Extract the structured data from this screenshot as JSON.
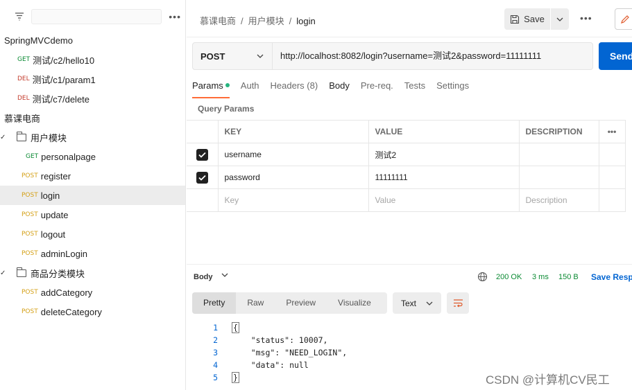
{
  "sidebar": {
    "more": "•••",
    "items": [
      {
        "kind": "collection",
        "label": "SpringMVCdemo"
      },
      {
        "kind": "request",
        "method": "GET",
        "label": "测试/c2/hello10"
      },
      {
        "kind": "request",
        "method": "DEL",
        "label": "测试/c1/param1"
      },
      {
        "kind": "request",
        "method": "DEL",
        "label": "测试/c7/delete"
      },
      {
        "kind": "collection",
        "label": "慕课电商"
      },
      {
        "kind": "folder",
        "label": "用户模块"
      },
      {
        "kind": "request",
        "method": "GET",
        "label": "personalpage"
      },
      {
        "kind": "request",
        "method": "POST",
        "label": "register"
      },
      {
        "kind": "request",
        "method": "POST",
        "label": "login"
      },
      {
        "kind": "request",
        "method": "POST",
        "label": "update"
      },
      {
        "kind": "request",
        "method": "POST",
        "label": "logout"
      },
      {
        "kind": "request",
        "method": "POST",
        "label": "adminLogin"
      },
      {
        "kind": "folder",
        "label": "商品分类模块"
      },
      {
        "kind": "request",
        "method": "POST",
        "label": "addCategory"
      },
      {
        "kind": "request",
        "method": "POST",
        "label": "deleteCategory"
      }
    ]
  },
  "breadcrumb": {
    "collection": "慕课电商",
    "folder": "用户模块",
    "current": "login",
    "sep": "/"
  },
  "toolbar": {
    "save_label": "Save",
    "more": "•••"
  },
  "request": {
    "method": "POST",
    "url": "http://localhost:8082/login?username=测试2&password=11111111",
    "send_label": "Send"
  },
  "tabs": {
    "params": "Params",
    "auth": "Auth",
    "headers": "Headers (8)",
    "body": "Body",
    "prereq": "Pre-req.",
    "tests": "Tests",
    "settings": "Settings"
  },
  "params": {
    "section_label": "Query Params",
    "headers": {
      "key": "KEY",
      "value": "VALUE",
      "description": "DESCRIPTION",
      "more": "•••"
    },
    "rows": [
      {
        "key": "username",
        "value": "测试2"
      },
      {
        "key": "password",
        "value": "11111111"
      }
    ],
    "placeholder": {
      "key": "Key",
      "value": "Value",
      "description": "Description"
    }
  },
  "response": {
    "body_label": "Body",
    "status": "200 OK",
    "time": "3 ms",
    "size": "150 B",
    "save_label": "Save Response",
    "views": {
      "pretty": "Pretty",
      "raw": "Raw",
      "preview": "Preview",
      "visualize": "Visualize"
    },
    "format": "Text",
    "lines": [
      {
        "n": "1",
        "text": "{"
      },
      {
        "n": "2",
        "text": "    \"status\": 10007,"
      },
      {
        "n": "3",
        "text": "    \"msg\": \"NEED_LOGIN\","
      },
      {
        "n": "4",
        "text": "    \"data\": null"
      },
      {
        "n": "5",
        "text": "}"
      }
    ]
  },
  "watermark": "CSDN @计算机CV民工",
  "colors": {
    "accent": "#ff6c37",
    "send": "#0265d2",
    "get": "#0b8a33",
    "del": "#c33b2c",
    "post": "#d4a017"
  }
}
